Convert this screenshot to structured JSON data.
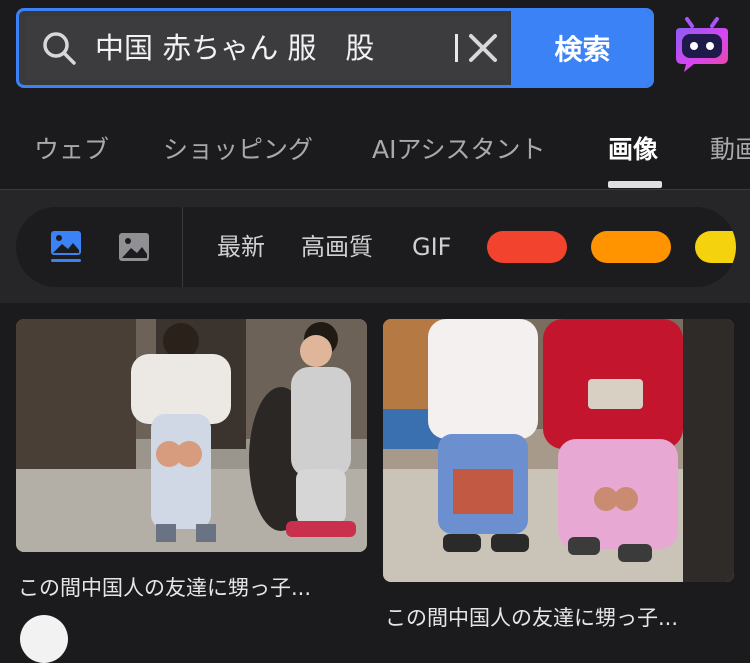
{
  "search": {
    "query": "中国 赤ちゃん 服　股",
    "submit_label": "検索"
  },
  "tabs": [
    {
      "label": "ウェブ"
    },
    {
      "label": "ショッピング"
    },
    {
      "label": "AIアシスタント"
    },
    {
      "label": "画像"
    },
    {
      "label": "動画"
    }
  ],
  "active_tab": "画像",
  "filters": {
    "options": [
      "最新",
      "高画質",
      "GIF"
    ],
    "color_swatches": [
      "#f2432f",
      "#ff9400",
      "#f4d20e"
    ],
    "accent": "#3b82f6"
  },
  "results": [
    {
      "caption": "この間中国人の友達に甥っ子..."
    },
    {
      "caption": "この間中国人の友達に甥っ子..."
    }
  ]
}
